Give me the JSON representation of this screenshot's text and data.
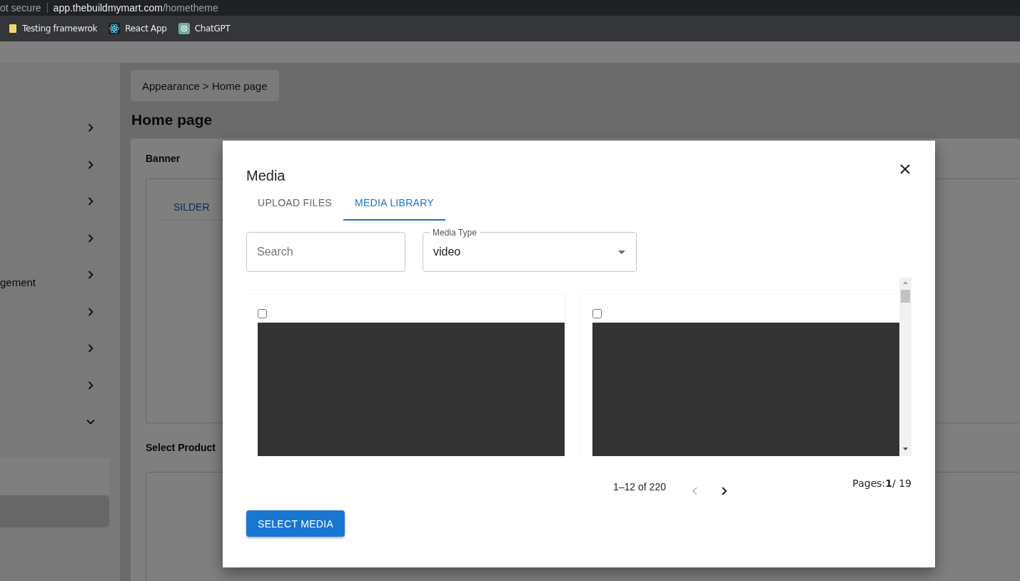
{
  "browser": {
    "security": "ot secure",
    "url_host": "app.thebuildmymart.com",
    "url_path": "/hometheme",
    "bookmarks": [
      {
        "label": "Testing framewrok",
        "kind": "folder"
      },
      {
        "label": "React App",
        "kind": "react"
      },
      {
        "label": "ChatGPT",
        "kind": "chatgpt"
      }
    ]
  },
  "sidebar": {
    "items": [
      {
        "expanded": false
      },
      {
        "expanded": false
      },
      {
        "expanded": false
      },
      {
        "expanded": false
      },
      {
        "label": "gement",
        "expanded": false
      },
      {
        "expanded": false
      },
      {
        "expanded": false
      },
      {
        "expanded": false
      },
      {
        "expanded": true,
        "children": [
          {
            "selected": false
          },
          {
            "selected": true
          }
        ]
      }
    ]
  },
  "breadcrumb": "Appearance > Home page",
  "heading": "Home page",
  "banner": {
    "title": "Banner",
    "tabs": [
      {
        "label": "SILDER",
        "selected": true
      }
    ]
  },
  "select_product": {
    "title": "Select Product"
  },
  "modal": {
    "title": "Media",
    "tabs": [
      {
        "label": "UPLOAD FILES",
        "selected": false
      },
      {
        "label": "MEDIA LIBRARY",
        "selected": true
      }
    ],
    "search": {
      "placeholder": "Search"
    },
    "media_type": {
      "label": "Media Type",
      "value": "video"
    },
    "items": [
      {
        "checked": false
      },
      {
        "checked": false
      }
    ],
    "pagination": {
      "range": "1–12 of 220",
      "prev_disabled": true,
      "next_disabled": false
    },
    "pages": "Pages:**1**/ 19",
    "button": "SELECT MEDIA"
  }
}
